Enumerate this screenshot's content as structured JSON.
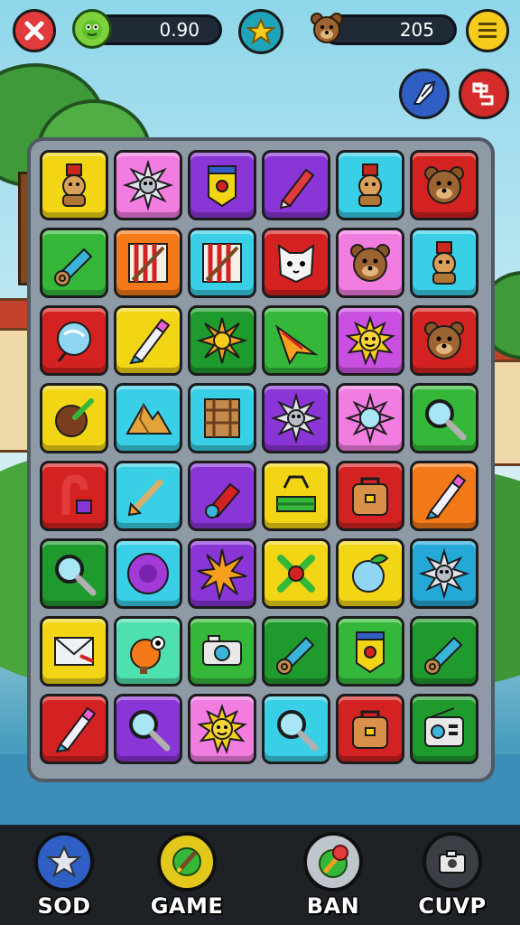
{
  "top_bar": {
    "close_icon": "close-icon",
    "energy": {
      "icon": "green-creature-icon",
      "value": "0.90"
    },
    "star_icon": "star-icon",
    "coins": {
      "icon": "bear-icon",
      "value": "205"
    },
    "menu_icon": "menu-icon"
  },
  "side_buttons": [
    {
      "name": "arrow-powerup-button",
      "icon": "arrow-icon",
      "color": "#2f5fc4"
    },
    {
      "name": "shuffle-powerup-button",
      "icon": "shuffle-icon",
      "color": "#d62b2b"
    }
  ],
  "board": {
    "rows": 8,
    "cols": 6,
    "tiles": [
      [
        {
          "color": "#f2d616",
          "icon": "figure-hat-icon"
        },
        {
          "color": "#f27de0",
          "icon": "spiky-ball-icon"
        },
        {
          "color": "#8a35d6",
          "icon": "banner-icon"
        },
        {
          "color": "#8a35d6",
          "icon": "pencil-icon"
        },
        {
          "color": "#39cfe6",
          "icon": "figure-hat-icon"
        },
        {
          "color": "#d42222",
          "icon": "bear-icon"
        }
      ],
      [
        {
          "color": "#35b83a",
          "icon": "scroll-icon"
        },
        {
          "color": "#f47a19",
          "icon": "striped-crate-icon"
        },
        {
          "color": "#39cfe6",
          "icon": "striped-crate-icon"
        },
        {
          "color": "#d42222",
          "icon": "cat-face-icon"
        },
        {
          "color": "#f27de0",
          "icon": "bear-icon"
        },
        {
          "color": "#39cfe6",
          "icon": "figure-hat-icon"
        }
      ],
      [
        {
          "color": "#d42222",
          "icon": "orb-icon"
        },
        {
          "color": "#f2d616",
          "icon": "crayon-icon"
        },
        {
          "color": "#1f9a2d",
          "icon": "sun-icon"
        },
        {
          "color": "#35b83a",
          "icon": "arrowhead-icon"
        },
        {
          "color": "#c94fe0",
          "icon": "sun-face-icon"
        },
        {
          "color": "#d42222",
          "icon": "bear-icon"
        }
      ],
      [
        {
          "color": "#f2d616",
          "icon": "coconut-icon"
        },
        {
          "color": "#39cfe6",
          "icon": "mountain-icon"
        },
        {
          "color": "#39cfe6",
          "icon": "crate-icon"
        },
        {
          "color": "#8a35d6",
          "icon": "spiky-ball-icon"
        },
        {
          "color": "#f27de0",
          "icon": "spiky-orb-icon"
        },
        {
          "color": "#35b83a",
          "icon": "magnifier-icon"
        }
      ],
      [
        {
          "color": "#d42222",
          "icon": "candy-cane-icon"
        },
        {
          "color": "#39cfe6",
          "icon": "arrow-icon"
        },
        {
          "color": "#8a35d6",
          "icon": "flashlight-icon"
        },
        {
          "color": "#f2d616",
          "icon": "basket-icon"
        },
        {
          "color": "#d42222",
          "icon": "bag-icon"
        },
        {
          "color": "#f47a19",
          "icon": "crayon-icon"
        }
      ],
      [
        {
          "color": "#1f9a2d",
          "icon": "magnifier-icon"
        },
        {
          "color": "#39cfe6",
          "icon": "flower-icon"
        },
        {
          "color": "#8a35d6",
          "icon": "star-burst-icon"
        },
        {
          "color": "#f2d616",
          "icon": "cross-icon"
        },
        {
          "color": "#f2d616",
          "icon": "apple-icon"
        },
        {
          "color": "#24a8d6",
          "icon": "spiky-ball-icon"
        }
      ],
      [
        {
          "color": "#f2d616",
          "icon": "envelope-icon"
        },
        {
          "color": "#4fe0b0",
          "icon": "creature-icon"
        },
        {
          "color": "#35b83a",
          "icon": "camera-icon"
        },
        {
          "color": "#1f9a2d",
          "icon": "scroll-icon"
        },
        {
          "color": "#35b83a",
          "icon": "banner-icon"
        },
        {
          "color": "#1f9a2d",
          "icon": "scroll-icon"
        }
      ],
      [
        {
          "color": "#d42222",
          "icon": "crayon-icon"
        },
        {
          "color": "#8a35d6",
          "icon": "magnifier-icon"
        },
        {
          "color": "#f27de0",
          "icon": "sun-face-icon"
        },
        {
          "color": "#39cfe6",
          "icon": "magnifier-icon"
        },
        {
          "color": "#d42222",
          "icon": "bag-icon"
        },
        {
          "color": "#1f9a2d",
          "icon": "radio-icon"
        }
      ]
    ]
  },
  "bottom_nav": [
    {
      "label": "SOD",
      "icon": "star-icon",
      "color": "#2f5fc4"
    },
    {
      "label": "GAME",
      "icon": "pencil-icon",
      "color": "#e3c81c"
    },
    {
      "label": "BAN",
      "icon": "joystick-icon",
      "color": "#35b83a"
    },
    {
      "label": "CUVP",
      "icon": "camera-icon",
      "color": "#3a3f45"
    }
  ]
}
